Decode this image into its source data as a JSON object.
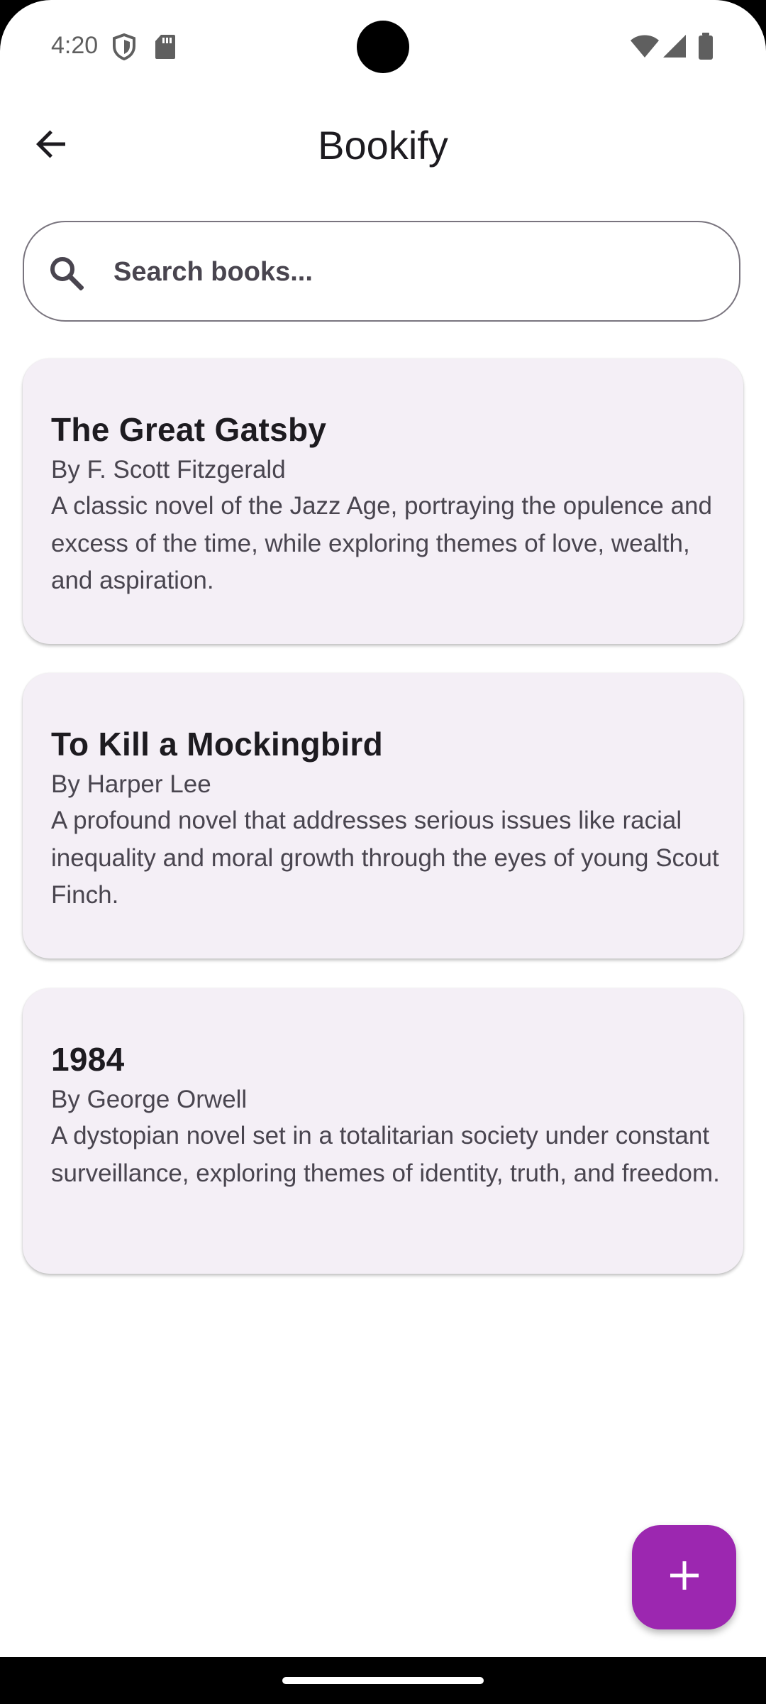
{
  "status_bar": {
    "time": "4:20"
  },
  "app_bar": {
    "title": "Bookify",
    "back_icon": "arrow-back-icon"
  },
  "search": {
    "placeholder": "Search books...",
    "icon": "search-icon"
  },
  "books": [
    {
      "title": "The Great Gatsby",
      "author": "By F. Scott Fitzgerald",
      "description": "A classic novel of the Jazz Age, portraying the opulence and excess of the time, while exploring themes of love, wealth, and aspiration."
    },
    {
      "title": "To Kill a Mockingbird",
      "author": "By Harper Lee",
      "description": "A profound novel that addresses serious issues like racial inequality and moral growth through the eyes of young Scout Finch."
    },
    {
      "title": "1984",
      "author": "By George Orwell",
      "description": "A dystopian novel set in a totalitarian society under constant surveillance, exploring themes of identity, truth, and freedom."
    }
  ],
  "fab": {
    "icon": "add-icon"
  },
  "colors": {
    "fab": "#9c27b0",
    "card_background": "#f4eff6",
    "text_primary": "#1d1b20",
    "text_secondary": "#49454f",
    "outline": "#79747e"
  }
}
